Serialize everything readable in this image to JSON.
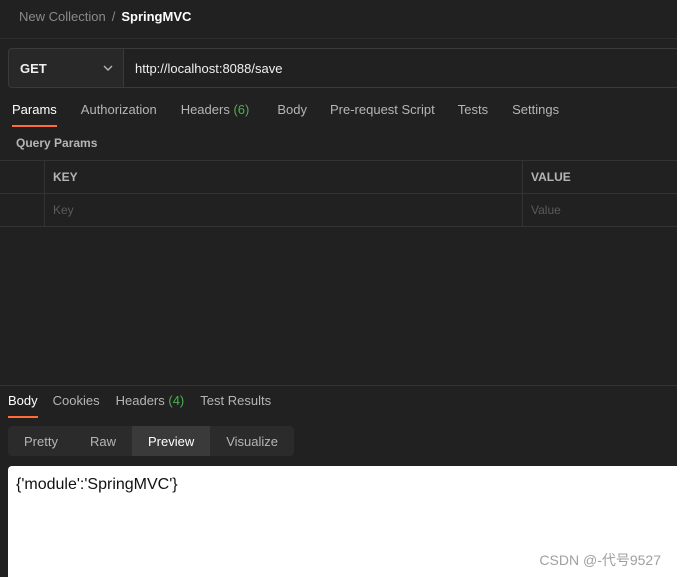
{
  "breadcrumb": {
    "collection": "New Collection",
    "separator": "/",
    "request": "SpringMVC"
  },
  "request": {
    "method": "GET",
    "url": "http://localhost:8088/save"
  },
  "request_tabs": [
    {
      "label": "Params",
      "count": "",
      "active": true
    },
    {
      "label": "Authorization",
      "count": ""
    },
    {
      "label": "Headers",
      "count": "(6)"
    },
    {
      "label": "Body",
      "count": ""
    },
    {
      "label": "Pre-request Script",
      "count": ""
    },
    {
      "label": "Tests",
      "count": ""
    },
    {
      "label": "Settings",
      "count": ""
    }
  ],
  "params": {
    "title": "Query Params",
    "columns": {
      "key": "KEY",
      "value": "VALUE"
    },
    "row_placeholders": {
      "key": "Key",
      "value": "Value"
    }
  },
  "response_tabs": [
    {
      "label": "Body",
      "count": "",
      "active": true
    },
    {
      "label": "Cookies",
      "count": ""
    },
    {
      "label": "Headers",
      "count": "(4)"
    },
    {
      "label": "Test Results",
      "count": ""
    }
  ],
  "view_modes": [
    {
      "label": "Pretty"
    },
    {
      "label": "Raw"
    },
    {
      "label": "Preview",
      "active": true
    },
    {
      "label": "Visualize"
    }
  ],
  "response_body": "{'module':'SpringMVC'}",
  "watermark": "CSDN @-代号9527",
  "colors": {
    "accent": "#ff6c37",
    "count": "#4caf50",
    "background": "#212121"
  }
}
